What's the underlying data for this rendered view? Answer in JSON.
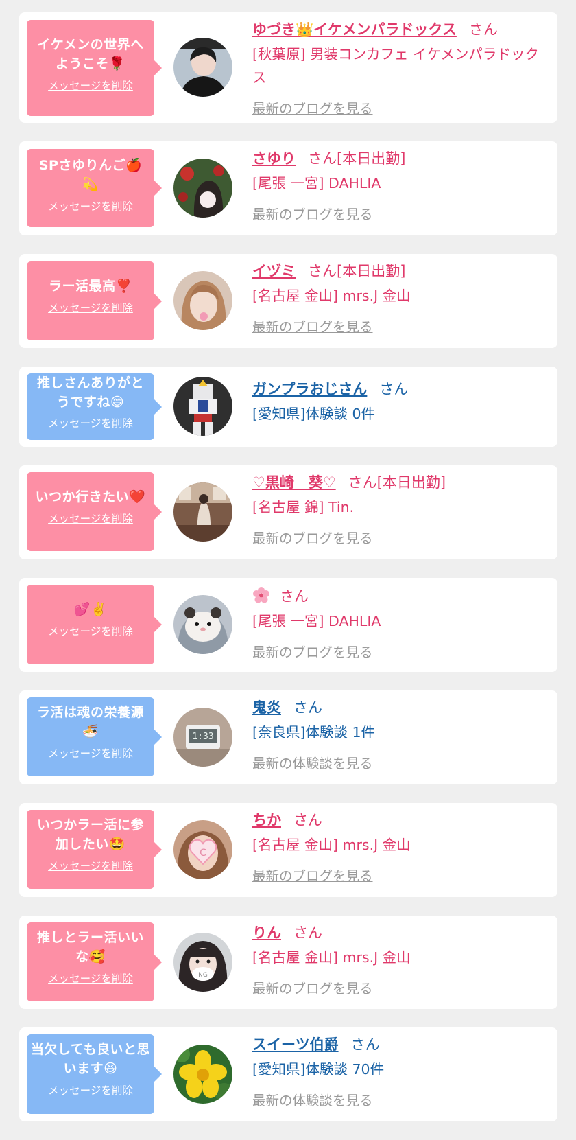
{
  "common": {
    "delete_label": "メッセージを削除",
    "san": "さん"
  },
  "colors": {
    "pink_bubble": "#fd8fa5",
    "blue_bubble": "#86b8f5",
    "pink_text": "#e0396a",
    "blue_text": "#1b63a6",
    "link_gray": "#9a9a9a",
    "background": "#efefef"
  },
  "cards": [
    {
      "bubble_color": "pink",
      "message": "イケメンの世界へようこそ🌹",
      "avatar_icon": "avatar-dark-costume-person",
      "name": "ゆづき👑イケメンパラドックス",
      "suffix": "",
      "shop": "[秋葉原] 男装コンカフェ イケメンパラドックス",
      "link": "最新のブログを見る"
    },
    {
      "bubble_color": "pink",
      "message": "SPさゆりんご🍎💫",
      "avatar_icon": "avatar-woman-with-fruit",
      "name": "さゆり",
      "suffix": "[本日出勤]",
      "shop": "[尾張 一宮] DAHLIA",
      "link": "最新のブログを見る"
    },
    {
      "bubble_color": "pink",
      "message": "ラー活最高❣️",
      "avatar_icon": "avatar-woman-blonde-hair",
      "name": "イヅミ",
      "suffix": "[本日出勤]",
      "shop": "[名古屋 金山] mrs.J 金山",
      "link": "最新のブログを見る"
    },
    {
      "bubble_color": "blue",
      "message": "推しさんありがとうですね😄",
      "avatar_icon": "avatar-gundam-model",
      "name": "ガンプラおじさん",
      "suffix": "",
      "shop": "[愛知県]体験談 0件",
      "link": ""
    },
    {
      "bubble_color": "pink",
      "message": "いつか行きたい❤️",
      "avatar_icon": "avatar-woman-in-room",
      "name": "♡黒崎　葵♡",
      "suffix": "[本日出勤]",
      "shop": "[名古屋 錦] Tin.",
      "link": "最新のブログを見る"
    },
    {
      "bubble_color": "pink",
      "message": "💕✌️",
      "avatar_icon": "avatar-hamster-face",
      "name": "",
      "name_icon": "cherry-blossom-icon",
      "suffix": "",
      "shop": "[尾張 一宮] DAHLIA",
      "link": "最新のブログを見る"
    },
    {
      "bubble_color": "blue",
      "message": "ラ活は魂の栄養源🍜",
      "avatar_icon": "avatar-digital-clock",
      "name": "鬼炎",
      "suffix": "",
      "shop": "[奈良県]体験談 1件",
      "link": "最新の体験談を見る"
    },
    {
      "bubble_color": "pink",
      "message": "いつかラー活に参加したい🤩",
      "avatar_icon": "avatar-heart-sticker-face",
      "name": "ちか",
      "suffix": "",
      "shop": "[名古屋 金山] mrs.J 金山",
      "link": "最新のブログを見る"
    },
    {
      "bubble_color": "pink",
      "message": "推しとラー活いいな🥰",
      "avatar_icon": "avatar-girl-with-mask",
      "name": "りん",
      "suffix": "",
      "shop": "[名古屋 金山] mrs.J 金山",
      "link": "最新のブログを見る"
    },
    {
      "bubble_color": "blue",
      "message": "当欠しても良いと思います😆",
      "avatar_icon": "avatar-yellow-flower",
      "name": "スイーツ伯爵",
      "suffix": "",
      "shop": "[愛知県]体験談 70件",
      "link": "最新の体験談を見る"
    }
  ]
}
